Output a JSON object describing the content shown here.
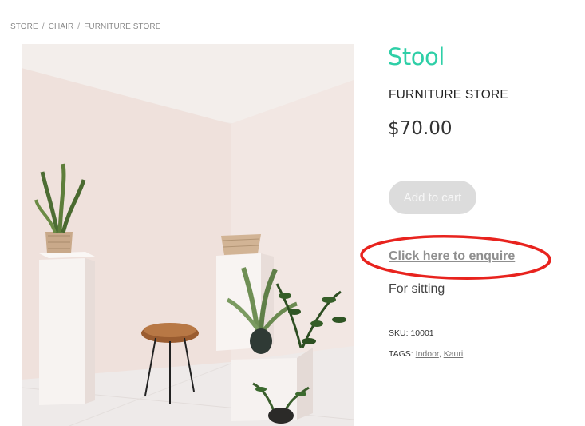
{
  "breadcrumb": {
    "items": [
      "STORE",
      "CHAIR",
      "FURNITURE STORE"
    ],
    "separator": "/"
  },
  "product": {
    "image_alt_icon": "product-photo",
    "title": "Stool",
    "store": "FURNITURE STORE",
    "price": "$70.00",
    "add_to_cart_label": "Add to cart",
    "enquire_label": "Click here to enquire",
    "description": "For sitting",
    "sku_label": "SKU:",
    "sku_value": "10001",
    "tags_label": "TAGS:",
    "tags": [
      "Indoor",
      "Kauri"
    ],
    "tag_separator": ","
  },
  "colors": {
    "accent": "#2ecfa7",
    "annotation": "#e8231e",
    "button_bg": "#dcdcdc"
  }
}
